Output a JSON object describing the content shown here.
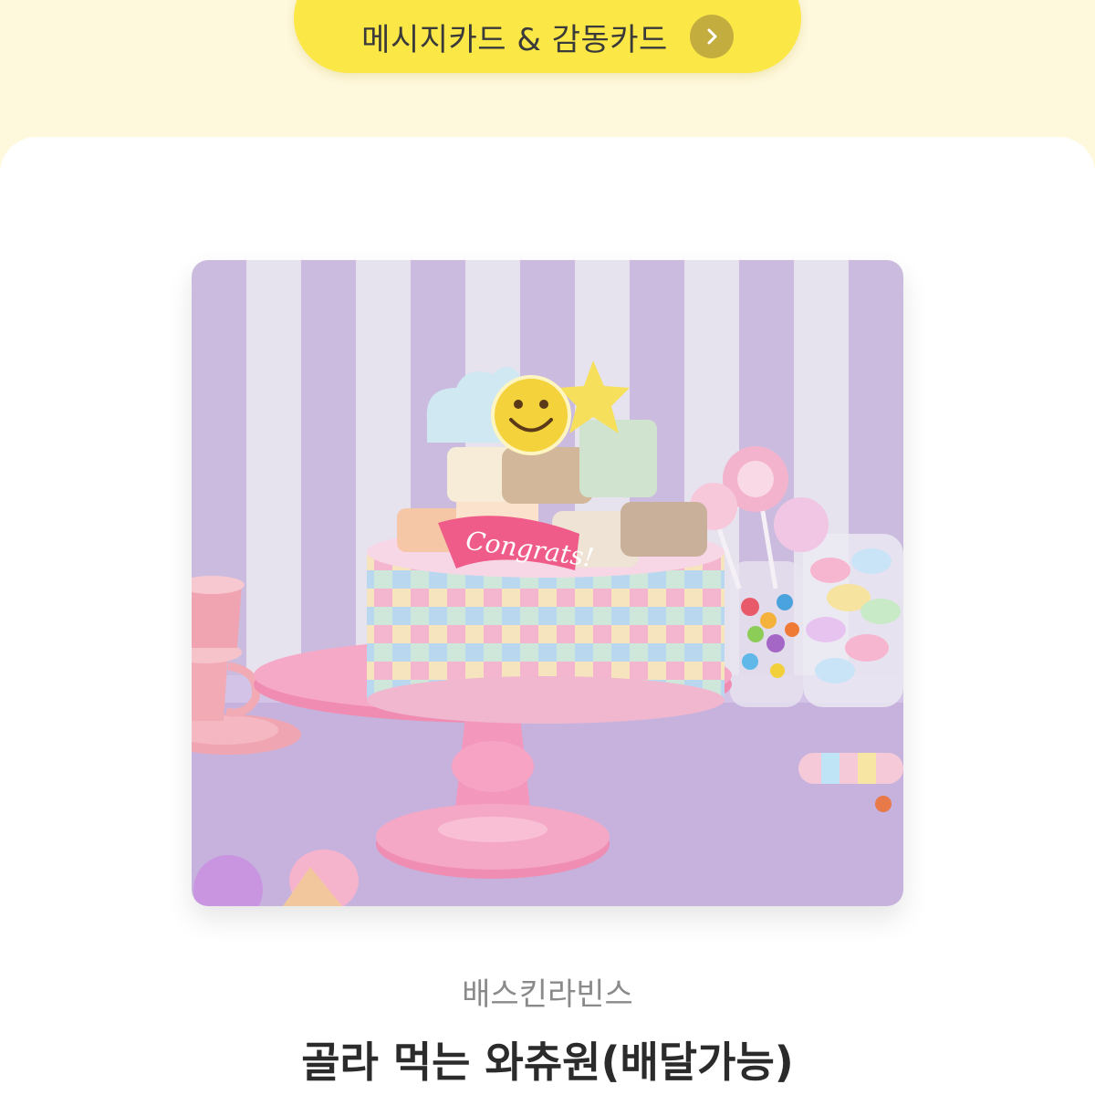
{
  "header": {
    "button_label": "메시지카드 & 감동카드",
    "button_icon": "chevron-right-icon"
  },
  "product": {
    "brand": "배스킨라빈스",
    "name": "골라 먹는 와츄원(배달가능)",
    "topper_text": "Congrats!"
  },
  "colors": {
    "page_background": "#fef8dd",
    "button_yellow": "#fbe745",
    "chevron_circle": "#c2ad3e"
  }
}
